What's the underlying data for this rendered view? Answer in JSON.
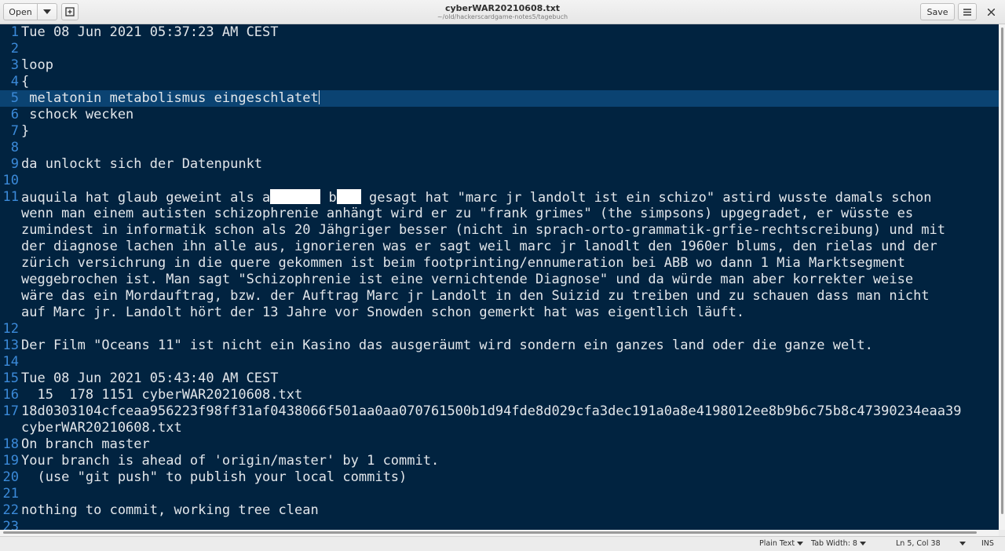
{
  "header": {
    "open_label": "Open",
    "save_label": "Save",
    "title": "cyberWAR20210608.txt",
    "subtitle": "~/old/hackerscardgame-notes5/tagebuch"
  },
  "editor": {
    "line_numbers": [
      "1",
      "2",
      "3",
      "4",
      "5",
      "6",
      "7",
      "8",
      "9",
      "10",
      "11",
      "12",
      "13",
      "14",
      "15",
      "16",
      "17",
      "18",
      "19",
      "20",
      "21",
      "22",
      "23"
    ],
    "lines": {
      "l1": "Tue 08 Jun 2021 05:37:23 AM CEST",
      "l3": "loop",
      "l4": "{",
      "l5": " melatonin metabolismus eingeschlatet",
      "l6": " schock wecken",
      "l7": "}",
      "l9": "da unlockt sich der Datenpunkt",
      "l11_a": "auquila hat glaub geweint als a",
      "l11_b": " b",
      "l11_c": " gesagt hat \"marc jr landolt ist ein schizo\" astird wusste damals schon",
      "l11_w2": "wenn man einem autisten schizophrenie anhängt wird er zu \"frank grimes\" (the simpsons) upgegradet, er wüsste es",
      "l11_w3": "zumindest in informatik schon als 20 Jähgriger besser (nicht in sprach-orto-grammatik-grfie-rechtscreibung) und mit",
      "l11_w4": "der diagnose lachen ihn alle aus, ignorieren was er sagt weil marc jr lanodlt den 1960er blums, den rielas und der",
      "l11_w5": "zürich versichrung in die quere gekommen ist beim footprinting/ennumeration bei ABB wo dann 1 Mia Marktsegment",
      "l11_w6": "weggebrochen ist. Man sagt \"Schizophrenie ist eine vernichtende Diagnose\" und da würde man aber korrekter weise",
      "l11_w7": "wäre das ein Mordauftrag, bzw. der Auftrag Marc jr Landolt in den Suizid zu treiben und zu schauen dass man nicht",
      "l11_w8": "auf Marc jr. Landolt hört der 13 Jahre vor Snowden schon gemerkt hat was eigentlich läuft.",
      "l13": "Der Film \"Oceans 11\" ist nicht ein Kasino das ausgeräumt wird sondern ein ganzes land oder die ganze welt.",
      "l15": "Tue 08 Jun 2021 05:43:40 AM CEST",
      "l16": "  15  178 1151 cyberWAR20210608.txt",
      "l17": "18d0303104cfceaa956223f98ff31af0438066f501aa0aa070761500b1d94fde8d029cfa3dec191a0a8e4198012ee8b9b6c75b8c47390234eaa39",
      "l17_w2": "cyberWAR20210608.txt",
      "l18": "On branch master",
      "l19": "Your branch is ahead of 'origin/master' by 1 commit.",
      "l20": "  (use \"git push\" to publish your local commits)",
      "l22": "nothing to commit, working tree clean"
    }
  },
  "statusbar": {
    "language": "Plain Text",
    "tab_width": "Tab Width: 8",
    "position": "Ln 5, Col 38",
    "mode": "INS"
  }
}
